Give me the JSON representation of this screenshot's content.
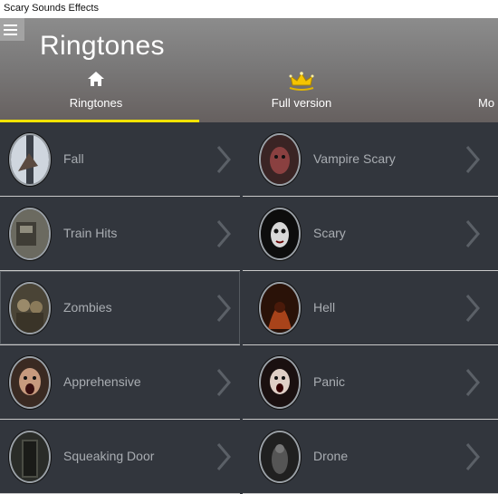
{
  "window": {
    "title": "Scary Sounds Effects"
  },
  "header": {
    "title": "Ringtones"
  },
  "tabs": [
    {
      "label": "Ringtones",
      "icon": "home-icon",
      "selected": true
    },
    {
      "label": "Full version",
      "icon": "crown-icon",
      "selected": false
    },
    {
      "label": "Mo",
      "icon": "",
      "selected": false
    }
  ],
  "ringtones": [
    {
      "name": "Fall",
      "icon": "fall-thumbnail"
    },
    {
      "name": "Vampire Scary",
      "icon": "vampire-thumbnail"
    },
    {
      "name": "Train Hits",
      "icon": "train-thumbnail"
    },
    {
      "name": "Scary",
      "icon": "scary-face-thumbnail"
    },
    {
      "name": "Zombies",
      "icon": "zombies-thumbnail"
    },
    {
      "name": "Hell",
      "icon": "hell-thumbnail"
    },
    {
      "name": "Apprehensive",
      "icon": "apprehensive-thumbnail"
    },
    {
      "name": "Panic",
      "icon": "panic-thumbnail"
    },
    {
      "name": "Squeaking Door",
      "icon": "door-thumbnail"
    },
    {
      "name": "Drone",
      "icon": "drone-thumbnail"
    }
  ],
  "colors": {
    "accent": "#f2e200",
    "background": "#32363d",
    "header": "#7a7979",
    "item_text": "#a9adb2"
  }
}
